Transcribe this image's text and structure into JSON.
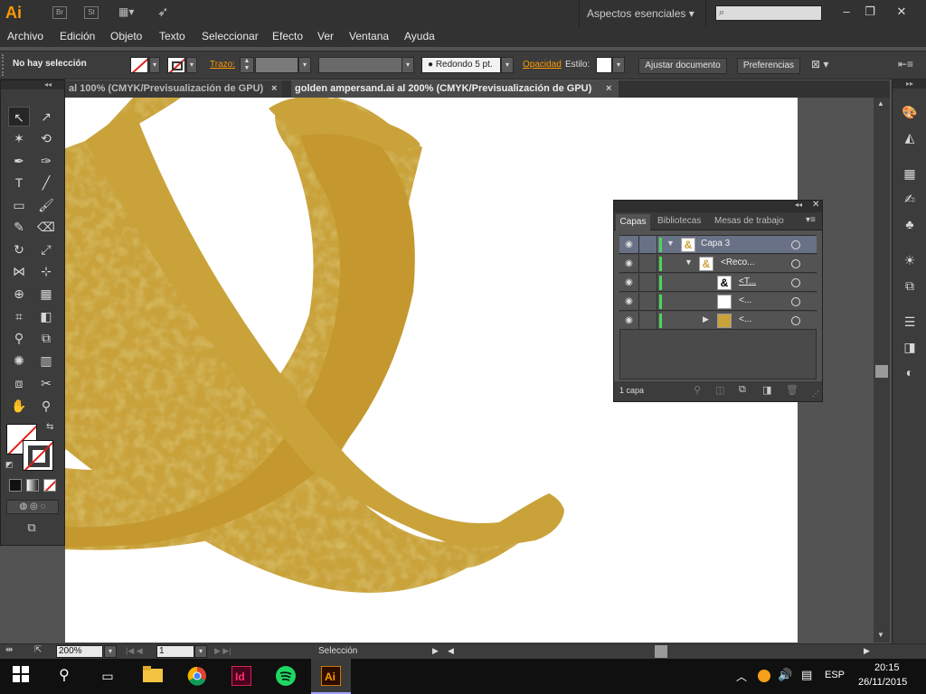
{
  "app": {
    "logo": "Ai",
    "bridge": "Br",
    "stock": "St",
    "workspace": "Aspectos esenciales"
  },
  "menu": [
    "Archivo",
    "Edición",
    "Objeto",
    "Texto",
    "Seleccionar",
    "Efecto",
    "Ver",
    "Ventana",
    "Ayuda"
  ],
  "control": {
    "selection": "No hay selección",
    "stroke_label": "Trazo:",
    "brush": "Redondo 5 pt.",
    "opacity_label": "Opacidad",
    "style_label": "Estilo:",
    "fit_document": "Ajustar documento",
    "preferences": "Preferencias"
  },
  "tabs": [
    {
      "label": "al 100% (CMYK/Previsualización de GPU)"
    },
    {
      "label": "golden ampersand.ai al 200% (CMYK/Previsualización de GPU)"
    }
  ],
  "layers_panel": {
    "tabs": [
      "Capas",
      "Bibliotecas",
      "Mesas de trabajo"
    ],
    "rows": [
      {
        "name": "Capa 3"
      },
      {
        "name": "<Reco..."
      },
      {
        "name": "<T..."
      },
      {
        "name": "<..."
      },
      {
        "name": "<..."
      }
    ],
    "footer": "1 capa"
  },
  "status": {
    "zoom": "200%",
    "page": "1",
    "tool": "Selección"
  },
  "taskbar": {
    "lang": "ESP",
    "time": "20:15",
    "date": "26/11/2015"
  },
  "colors": {
    "accent": "#ff9a00",
    "layer_color": "#4dd55b",
    "gold": "#c9a23a"
  }
}
